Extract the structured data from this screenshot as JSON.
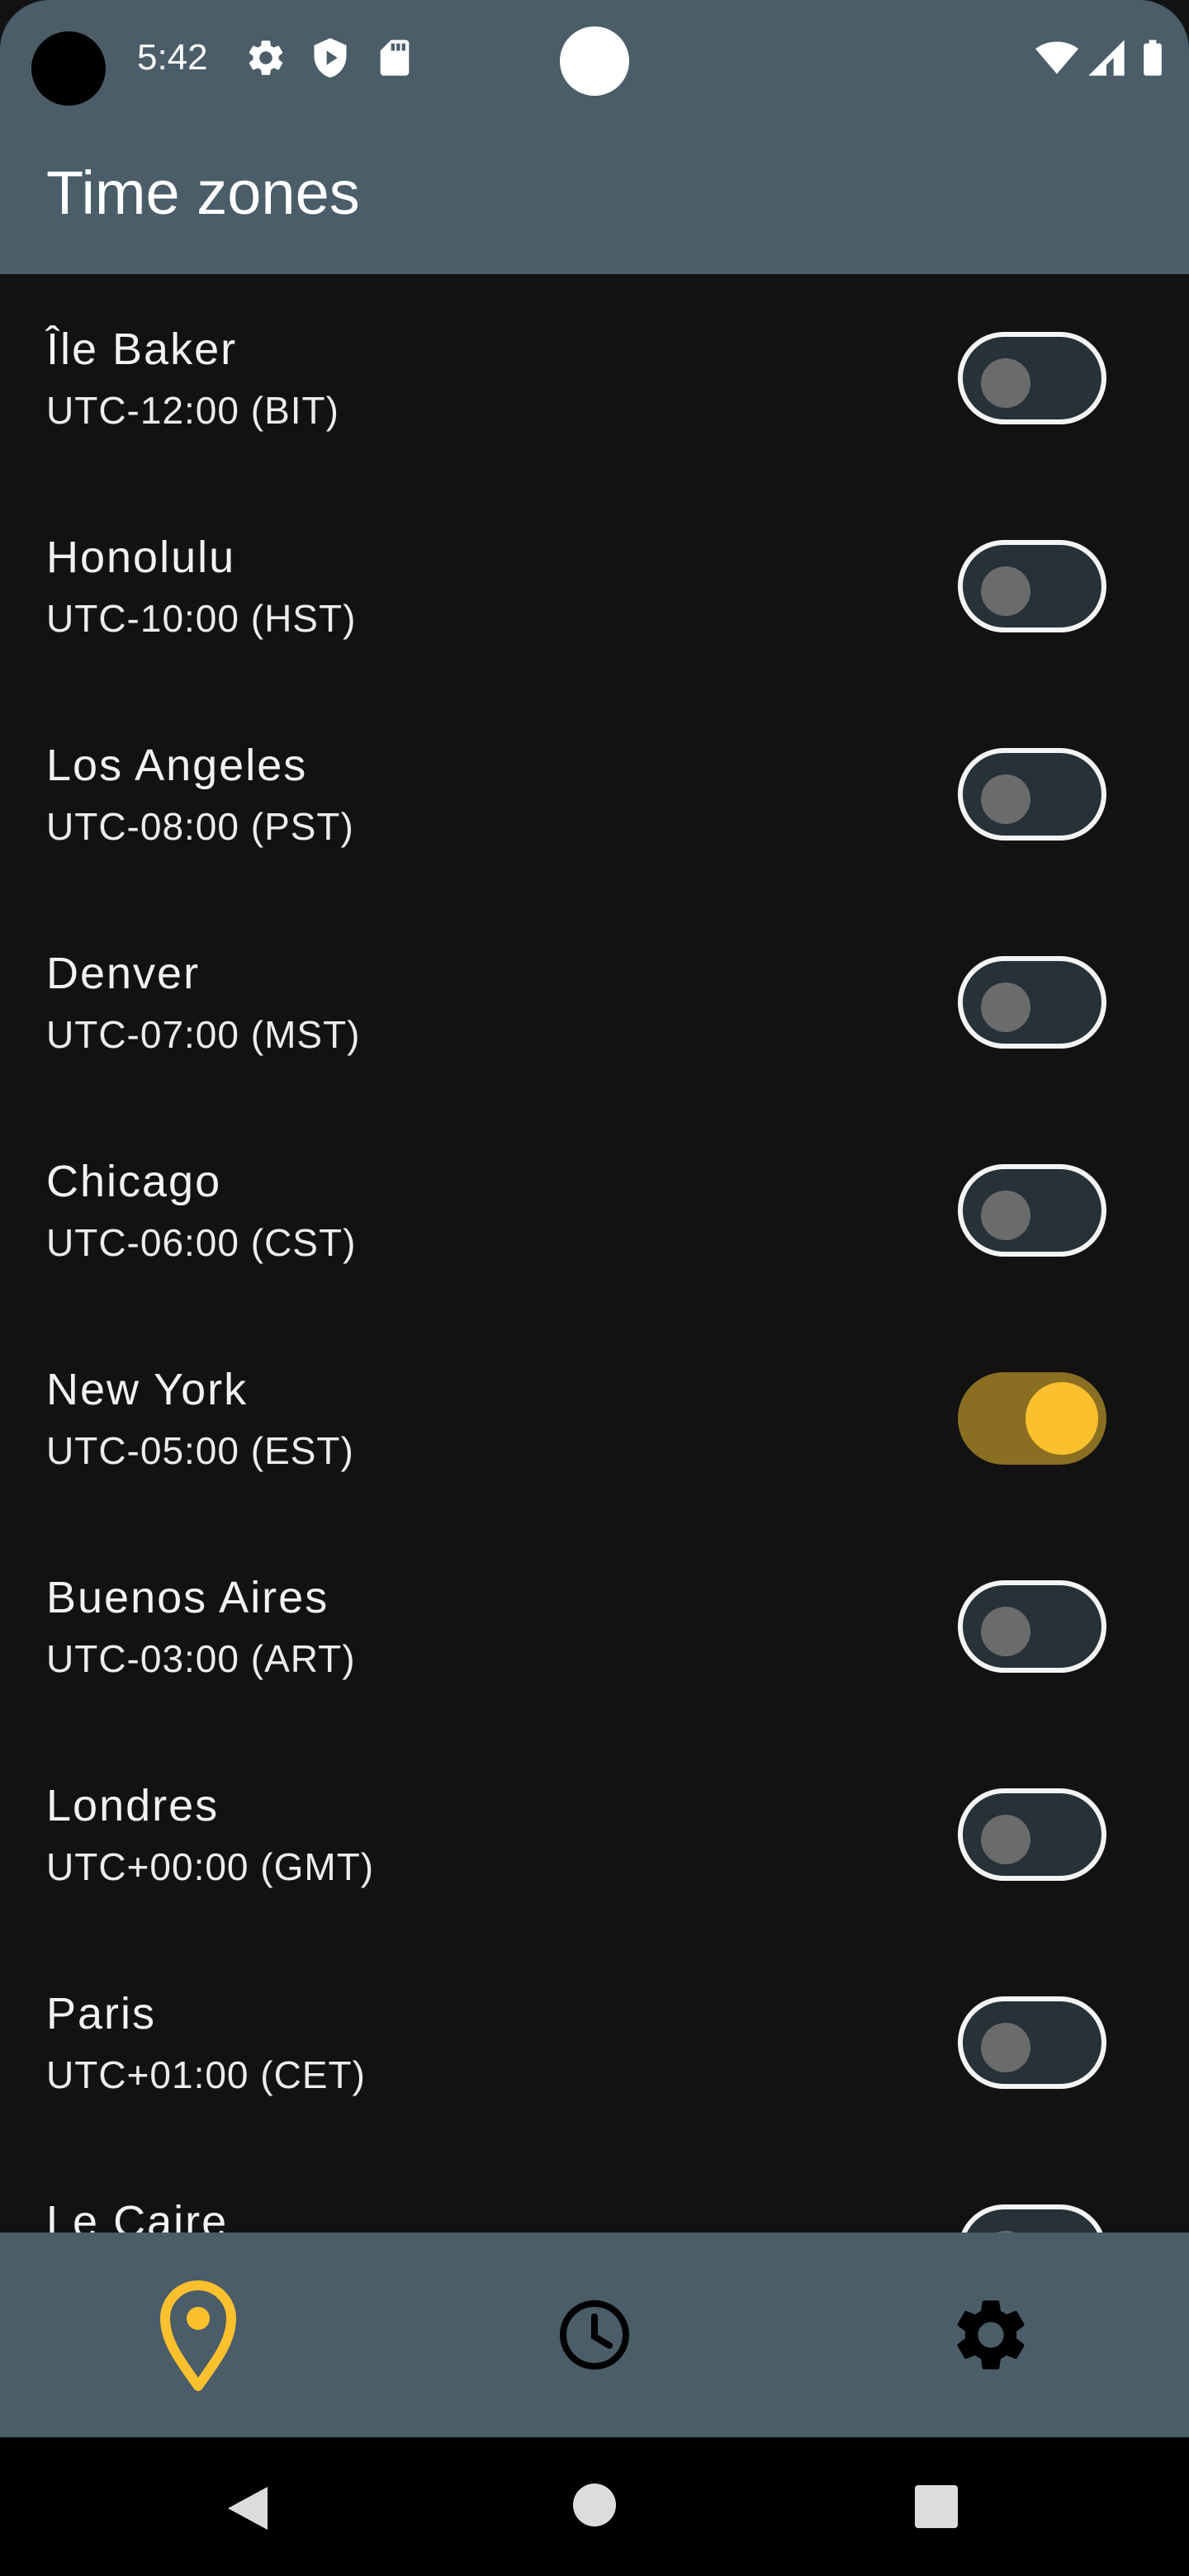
{
  "status_bar": {
    "time": "5:42",
    "icons": [
      "gear-icon",
      "shield-icon",
      "sd-card-icon",
      "wifi-icon",
      "signal-icon",
      "battery-icon"
    ]
  },
  "app_bar": {
    "title": "Time zones"
  },
  "time_zones": [
    {
      "city": "Île Baker",
      "offset": "UTC-12:00 (BIT)",
      "enabled": false
    },
    {
      "city": "Honolulu",
      "offset": "UTC-10:00 (HST)",
      "enabled": false
    },
    {
      "city": "Los Angeles",
      "offset": "UTC-08:00 (PST)",
      "enabled": false
    },
    {
      "city": "Denver",
      "offset": "UTC-07:00 (MST)",
      "enabled": false
    },
    {
      "city": "Chicago",
      "offset": "UTC-06:00 (CST)",
      "enabled": false
    },
    {
      "city": "New York",
      "offset": "UTC-05:00 (EST)",
      "enabled": true
    },
    {
      "city": "Buenos Aires",
      "offset": "UTC-03:00 (ART)",
      "enabled": false
    },
    {
      "city": "Londres",
      "offset": "UTC+00:00 (GMT)",
      "enabled": false
    },
    {
      "city": "Paris",
      "offset": "UTC+01:00 (CET)",
      "enabled": false
    },
    {
      "city": "Le Caire",
      "offset": "",
      "enabled": false
    }
  ],
  "bottom_nav": {
    "items": [
      {
        "icon": "location-pin-icon",
        "selected": true
      },
      {
        "icon": "clock-icon",
        "selected": false
      },
      {
        "icon": "gear-icon",
        "selected": false
      }
    ]
  },
  "system_nav": {
    "buttons": [
      "back-icon",
      "home-icon",
      "recents-icon"
    ]
  },
  "colors": {
    "bar_background": "#4a5d69",
    "list_background": "#121212",
    "accent": "#fbc02d",
    "accent_track": "#8a6f22",
    "toggle_off_track": "#263238"
  }
}
